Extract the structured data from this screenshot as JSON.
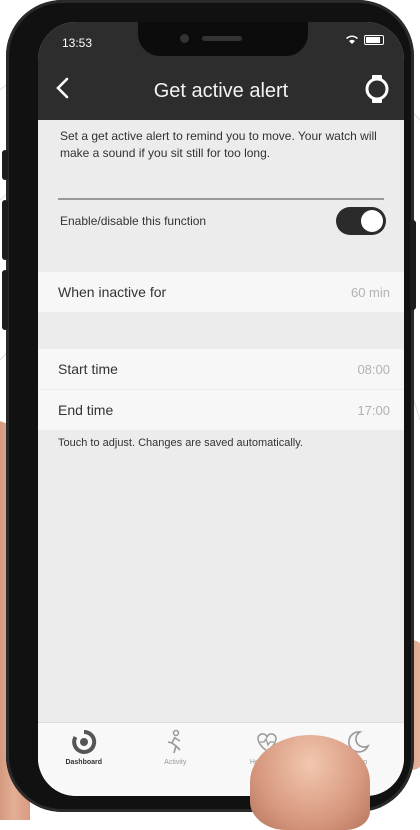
{
  "status_bar": {
    "time": "13:53"
  },
  "header": {
    "title": "Get active alert"
  },
  "description": "Set a get active alert to remind you to move. Your watch will make a sound if you sit still for too long.",
  "toggle": {
    "label": "Enable/disable this function",
    "enabled": true
  },
  "inactive": {
    "label": "When inactive for",
    "value": "60 min"
  },
  "schedule": {
    "start": {
      "label": "Start time",
      "value": "08:00"
    },
    "end": {
      "label": "End time",
      "value": "17:00"
    }
  },
  "hint": "Touch to adjust. Changes are saved automatically.",
  "tabbar": {
    "tabs": [
      {
        "label": "Dashboard",
        "icon": "dashboard-icon",
        "active": true
      },
      {
        "label": "Activity",
        "icon": "activity-icon",
        "active": false
      },
      {
        "label": "Heart Rate",
        "icon": "heart-rate-icon",
        "active": false
      },
      {
        "label": "Sleep",
        "icon": "sleep-icon",
        "active": false
      }
    ]
  },
  "colors": {
    "header_bg": "#2d2d2d",
    "screen_bg": "#ececec",
    "row_bg": "#f7f7f7",
    "toggle_on": "#2b2b2b"
  }
}
